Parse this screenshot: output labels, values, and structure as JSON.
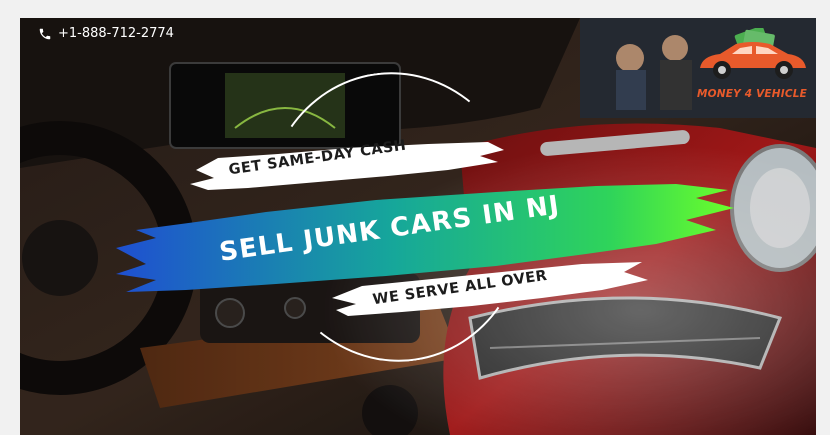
{
  "header": {
    "phone_icon": "phone-icon",
    "phone_number": "+1-888-712-2774"
  },
  "logo": {
    "text": "MONEY 4 VEHICLE",
    "brand_color": "#e85a2b"
  },
  "banner": {
    "headline_top": "GET SAME-DAY CASH",
    "headline_main": "SELL JUNK CARS IN NJ",
    "headline_bottom": "WE SERVE ALL OVER",
    "gradient_colors": [
      "#1f4fd1",
      "#16c08a",
      "#3ee04a"
    ]
  }
}
